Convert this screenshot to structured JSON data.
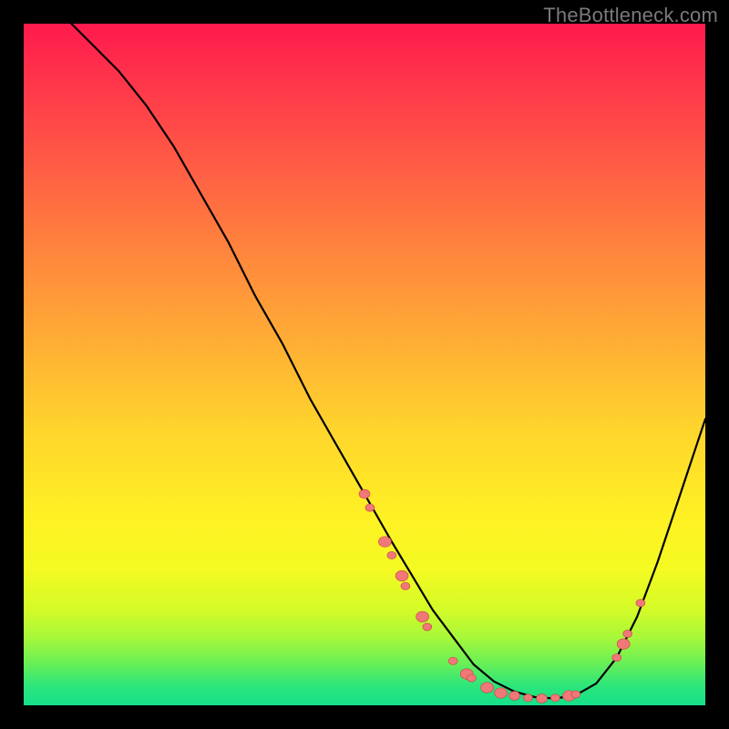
{
  "watermark": "TheBottleneck.com",
  "colors": {
    "gradient_top": "#ff1a4d",
    "gradient_bottom": "#14e08a",
    "curve": "#000000",
    "dot_fill": "#f07878",
    "dot_stroke": "#c84040",
    "frame_bg": "#000000"
  },
  "chart_data": {
    "type": "line",
    "title": "",
    "xlabel": "",
    "ylabel": "",
    "xlim": [
      0,
      100
    ],
    "ylim": [
      0,
      100
    ],
    "grid": false,
    "legend": false,
    "series": [
      {
        "name": "curve",
        "x": [
          7,
          10,
          14,
          18,
          22,
          26,
          30,
          34,
          38,
          42,
          46,
          50,
          54,
          57,
          60,
          63,
          66,
          69,
          72,
          75,
          78,
          81,
          84,
          87,
          90,
          93,
          96,
          99,
          100
        ],
        "y": [
          100,
          97,
          93,
          88,
          82,
          75,
          68,
          60,
          53,
          45,
          38,
          31,
          24,
          19,
          14,
          10,
          6,
          3.5,
          2,
          1.2,
          1,
          1.5,
          3.2,
          7,
          13,
          21,
          30,
          39,
          42
        ]
      }
    ],
    "points": [
      {
        "x": 50,
        "y": 31,
        "r": 6
      },
      {
        "x": 50.8,
        "y": 29,
        "r": 5
      },
      {
        "x": 53,
        "y": 24,
        "r": 7
      },
      {
        "x": 54,
        "y": 22,
        "r": 5
      },
      {
        "x": 55.5,
        "y": 19,
        "r": 7
      },
      {
        "x": 56,
        "y": 17.5,
        "r": 5
      },
      {
        "x": 58.5,
        "y": 13,
        "r": 7
      },
      {
        "x": 59.2,
        "y": 11.5,
        "r": 5
      },
      {
        "x": 63,
        "y": 6.5,
        "r": 5
      },
      {
        "x": 65,
        "y": 4.6,
        "r": 7
      },
      {
        "x": 65.7,
        "y": 4,
        "r": 5
      },
      {
        "x": 68,
        "y": 2.6,
        "r": 7
      },
      {
        "x": 70,
        "y": 1.8,
        "r": 7
      },
      {
        "x": 72,
        "y": 1.4,
        "r": 6
      },
      {
        "x": 74,
        "y": 1.1,
        "r": 5
      },
      {
        "x": 76,
        "y": 1.0,
        "r": 6
      },
      {
        "x": 78,
        "y": 1.1,
        "r": 5
      },
      {
        "x": 80,
        "y": 1.4,
        "r": 7
      },
      {
        "x": 81,
        "y": 1.6,
        "r": 5
      },
      {
        "x": 87,
        "y": 7,
        "r": 5
      },
      {
        "x": 88,
        "y": 9,
        "r": 7
      },
      {
        "x": 88.6,
        "y": 10.5,
        "r": 5
      },
      {
        "x": 90.5,
        "y": 15,
        "r": 5
      }
    ],
    "notes": "Values are read in percent of plot area. (0,0) is bottom-left of the colored square; (100,100) is top-left. y represents approximate height from the bottom edge. Curve traces a steep descent from upper-left, bottoms out near x≈77, then rises toward the right edge. Scatter points lie on the curve, clustered on the descending limb near x 50–60 and around the trough, plus a small cluster on the ascending limb near x 87–90."
  }
}
